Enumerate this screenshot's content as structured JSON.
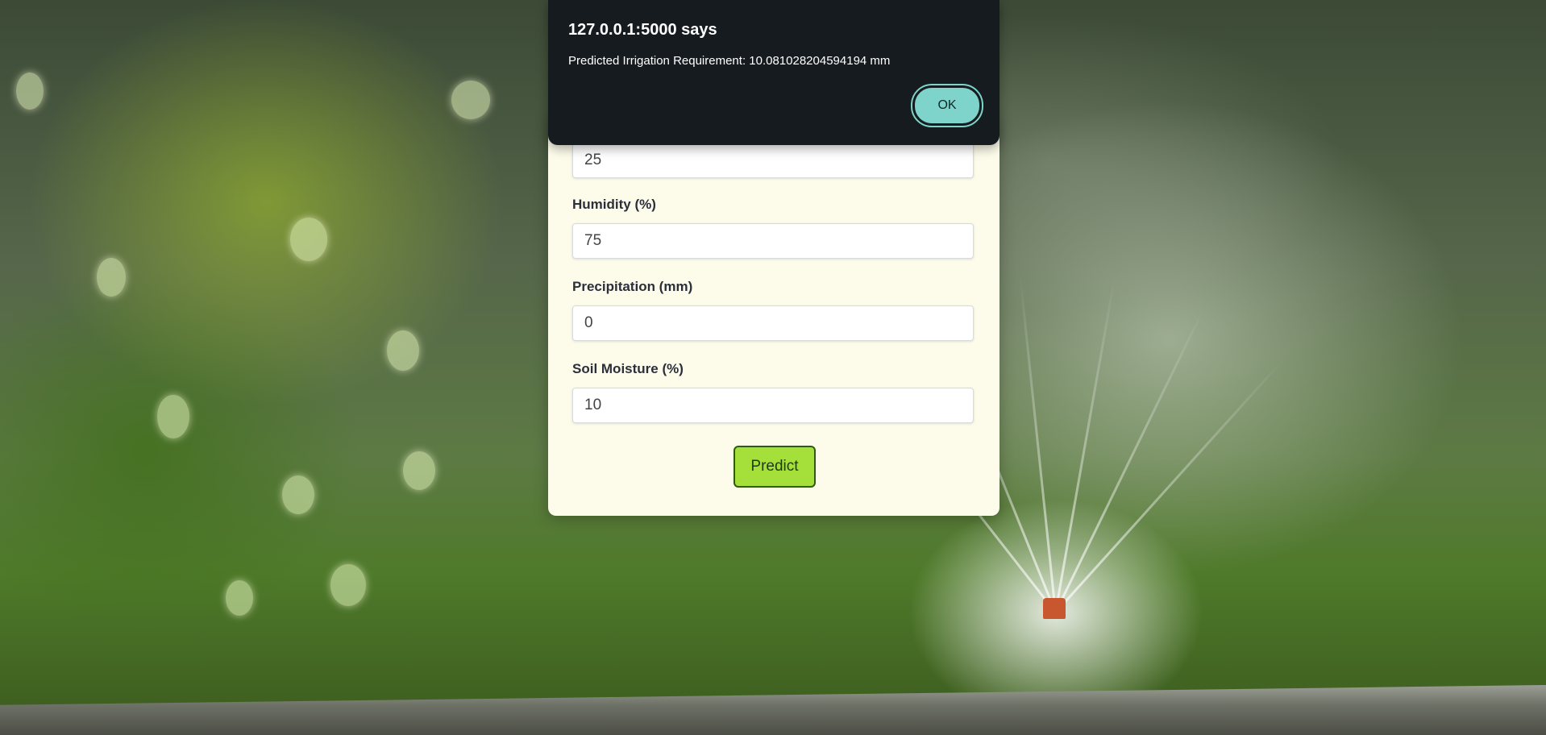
{
  "form": {
    "temperature_value": "25",
    "humidity_label": "Humidity (%)",
    "humidity_value": "75",
    "precipitation_label": "Precipitation (mm)",
    "precipitation_value": "0",
    "soil_moisture_label": "Soil Moisture (%)",
    "soil_moisture_value": "10",
    "predict_label": "Predict"
  },
  "dialog": {
    "title": "127.0.0.1:5000 says",
    "message": "Predicted Irrigation Requirement: 10.081028204594194 mm",
    "ok_label": "OK"
  },
  "colors": {
    "card_bg": "#fdfbe9",
    "predict_button": "#a5e03a",
    "dialog_bg": "#151b1e",
    "ok_button": "#7ed3ca"
  }
}
